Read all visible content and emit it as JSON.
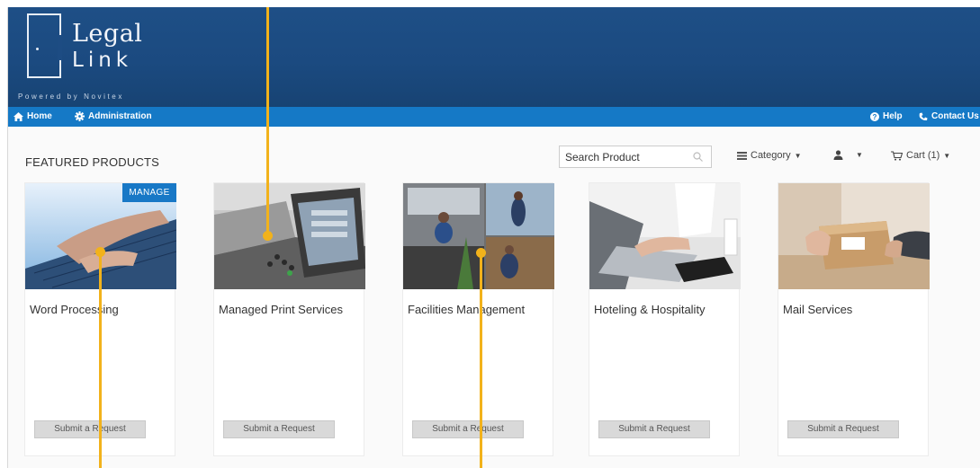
{
  "brand": {
    "name_line1": "Legal",
    "name_line2": "Link",
    "powered_by": "Powered by Novitex"
  },
  "nav": {
    "home": "Home",
    "administration": "Administration",
    "help": "Help",
    "contact": "Contact Us"
  },
  "page": {
    "title": "FEATURED PRODUCTS"
  },
  "toolbar": {
    "search_placeholder": "Search Product",
    "category": "Category",
    "cart": "Cart (1)"
  },
  "products": [
    {
      "title": "Word Processing",
      "button": "Submit a Request",
      "image": "typing-on-keyboard",
      "manage": "MANAGE"
    },
    {
      "title": "Managed Print Services",
      "button": "Submit a Request",
      "image": "printer-control-panel"
    },
    {
      "title": "Facilities Management",
      "button": "Submit a Request",
      "image": "office-staff-collage"
    },
    {
      "title": "Hoteling & Hospitality",
      "button": "Submit a Request",
      "image": "laptop-and-tablet"
    },
    {
      "title": "Mail Services",
      "button": "Submit a Request",
      "image": "package-handoff"
    }
  ],
  "colors": {
    "header_bg": "#1b4a80",
    "nav_bg": "#1579c6",
    "manage_bg": "#1878c6",
    "callout": "#f2b21b",
    "button_bg": "#d9d9d9"
  }
}
